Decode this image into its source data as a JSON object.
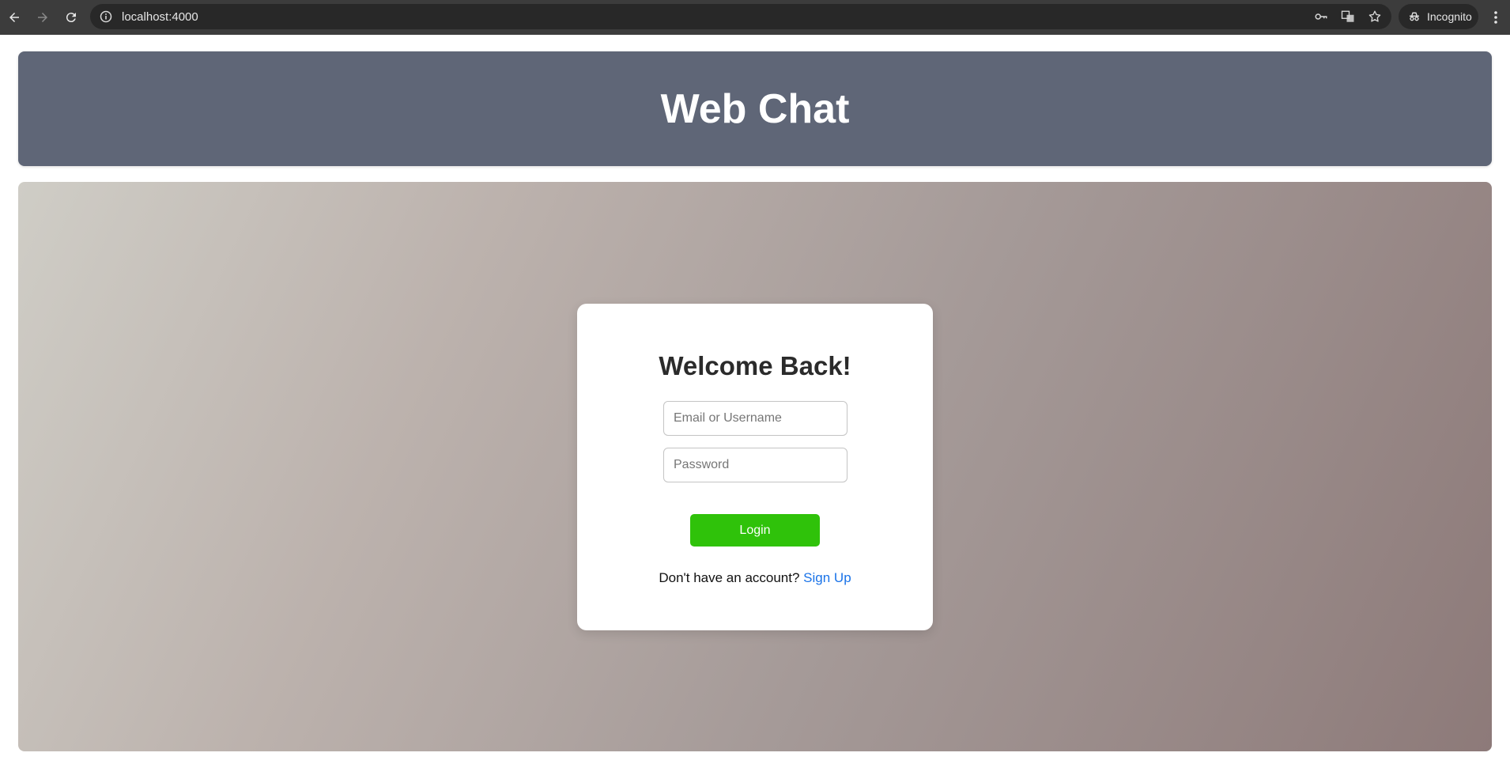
{
  "browser": {
    "url": "localhost:4000",
    "incognito_label": "Incognito"
  },
  "header": {
    "title": "Web Chat",
    "background": "#5f6677"
  },
  "login_card": {
    "title": "Welcome Back!",
    "email_placeholder": "Email or Username",
    "email_value": "",
    "password_placeholder": "Password",
    "password_value": "",
    "login_label": "Login",
    "login_color": "#2fc20a",
    "signup_prompt": "Don't have an account?",
    "signup_link": "Sign Up",
    "link_color": "#1a73e8"
  },
  "icons": [
    "back-arrow-icon",
    "forward-arrow-icon",
    "reload-icon",
    "site-info-icon",
    "password-key-icon",
    "translate-icon",
    "bookmark-star-icon",
    "incognito-icon",
    "more-menu-icon"
  ]
}
